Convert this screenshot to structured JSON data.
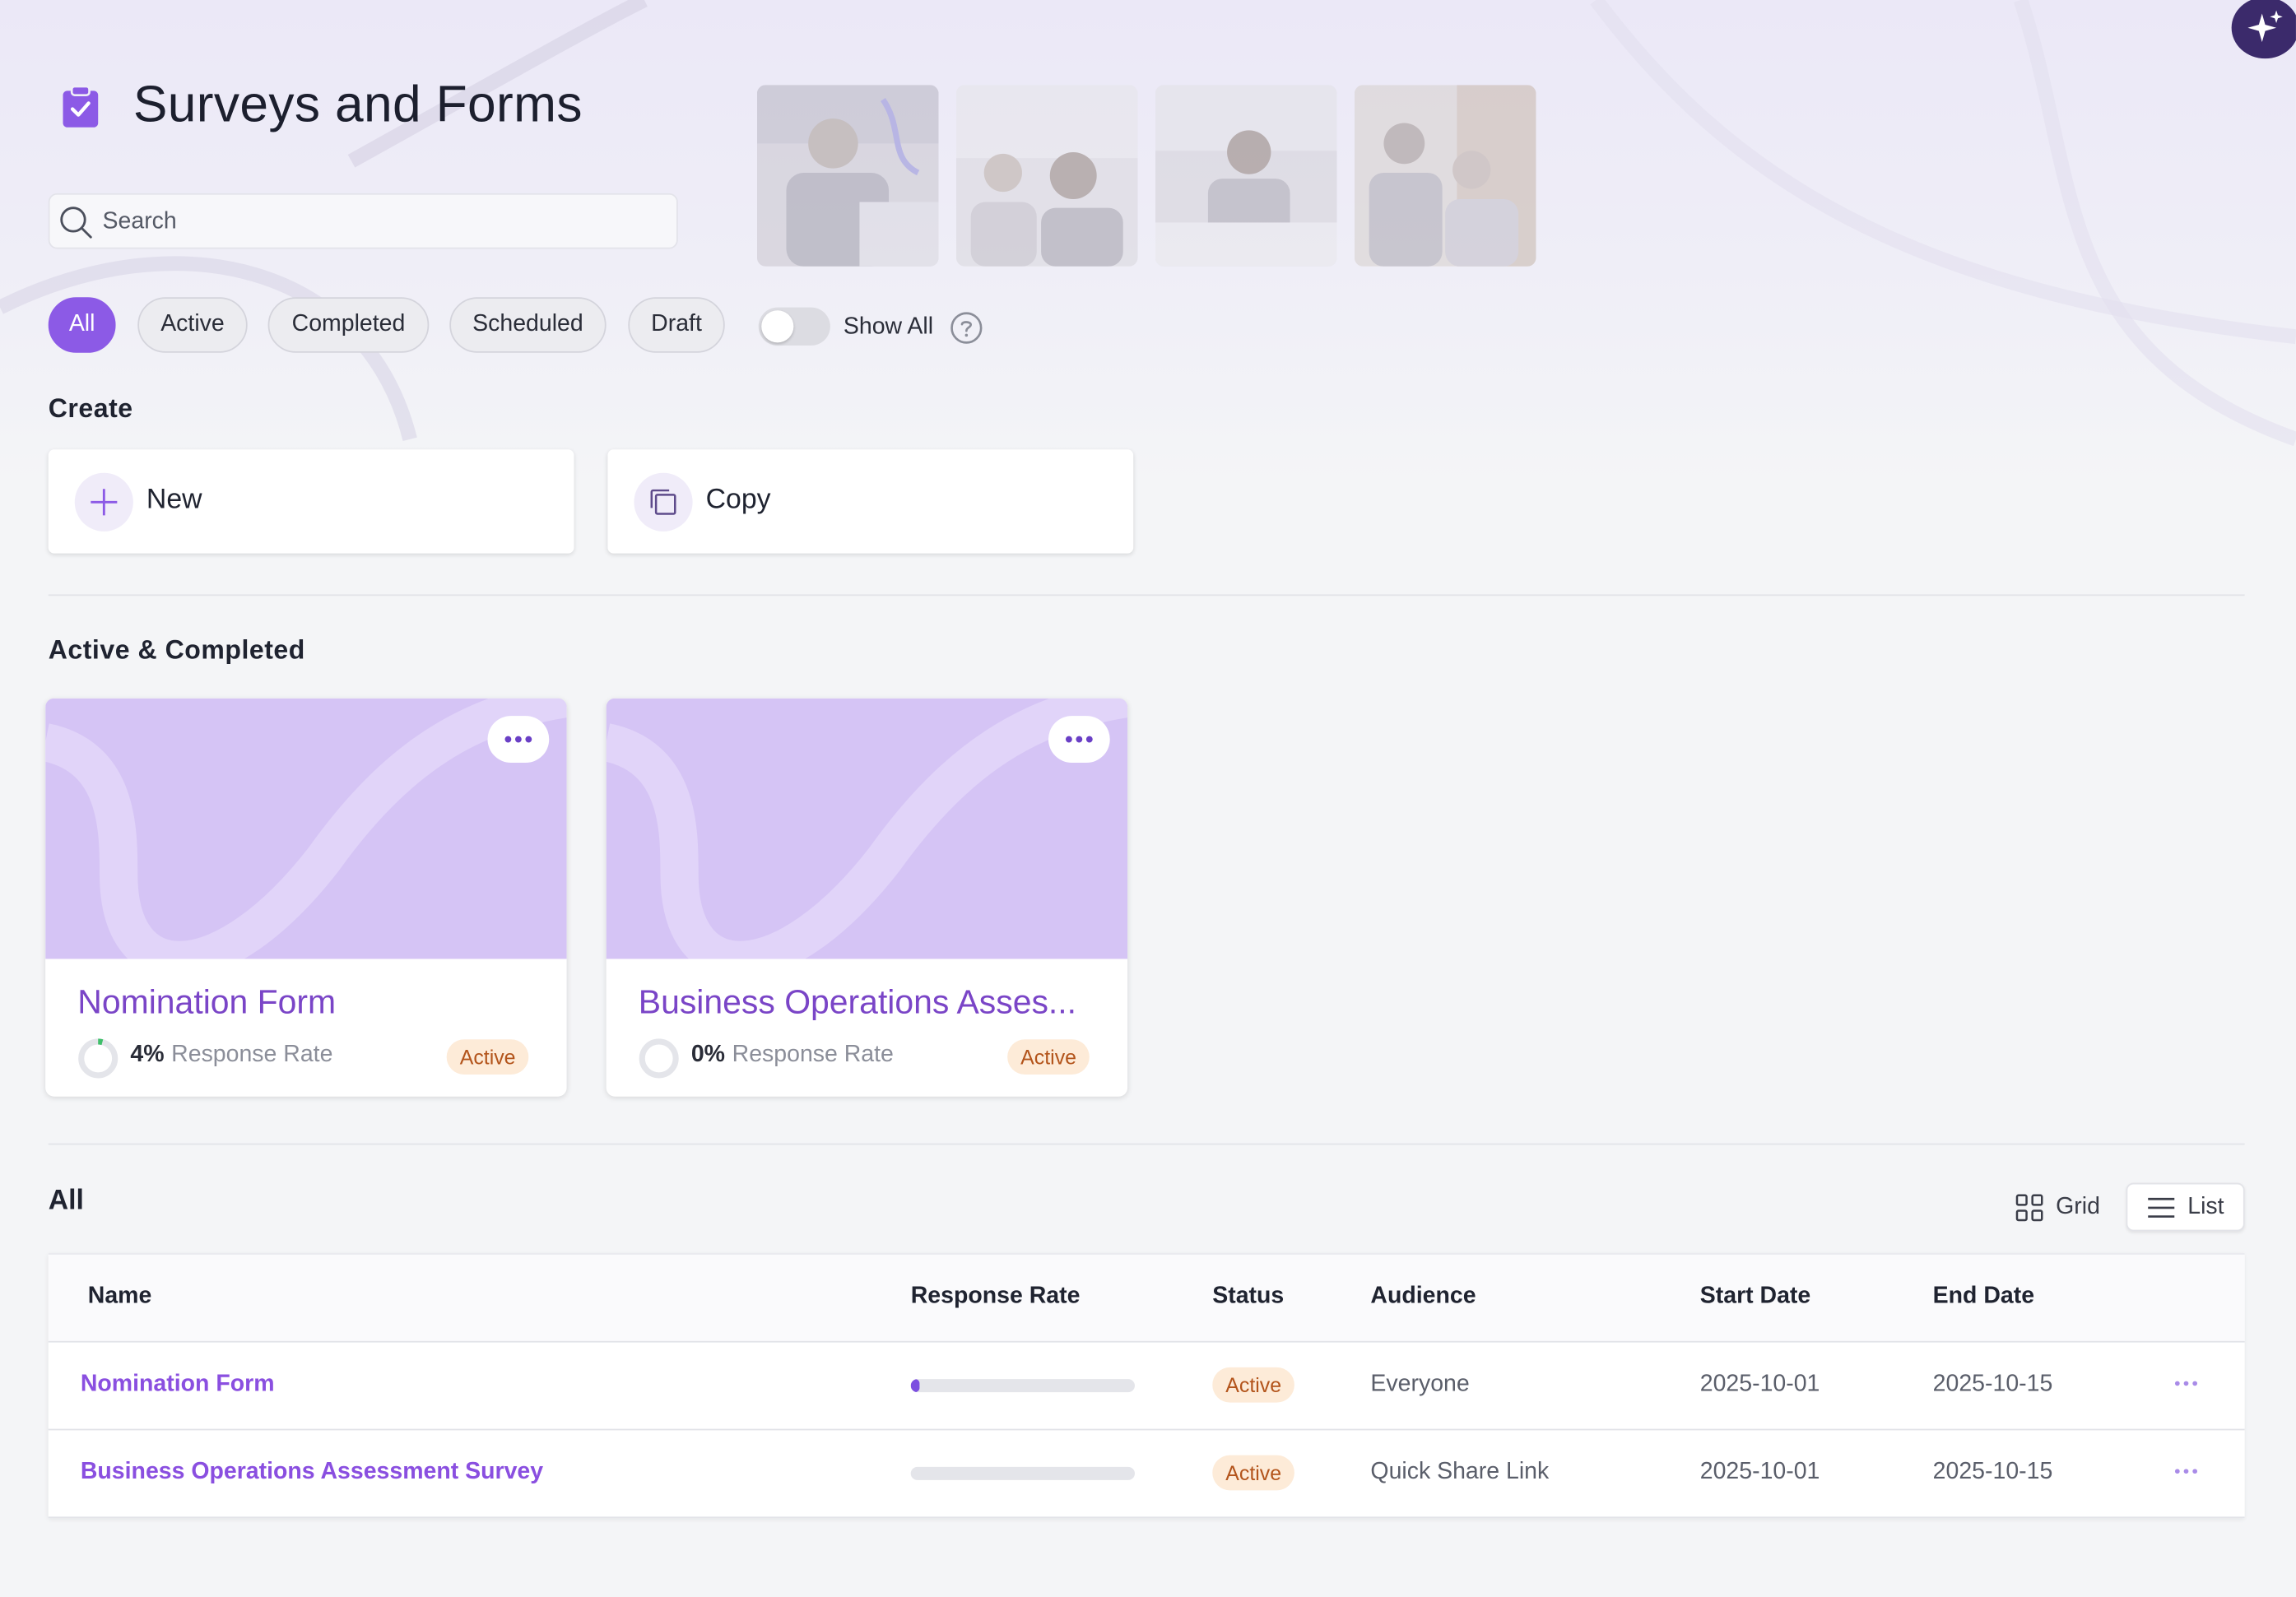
{
  "page": {
    "title": "Surveys and Forms",
    "icon": "clipboard-check-icon"
  },
  "search": {
    "placeholder": "Search"
  },
  "filters": [
    {
      "label": "All",
      "selected": true
    },
    {
      "label": "Active",
      "selected": false
    },
    {
      "label": "Completed",
      "selected": false
    },
    {
      "label": "Scheduled",
      "selected": false
    },
    {
      "label": "Draft",
      "selected": false
    }
  ],
  "show_all": {
    "label": "Show All",
    "on": false
  },
  "create": {
    "title": "Create",
    "new_label": "New",
    "copy_label": "Copy"
  },
  "active_completed": {
    "title": "Active & Completed",
    "cards": [
      {
        "title": "Nomination Form",
        "percent": "4%",
        "rate_label": "Response Rate",
        "status": "Active",
        "rate": 0.04
      },
      {
        "title": "Business Operations Asses...",
        "percent": "0%",
        "rate_label": "Response Rate",
        "status": "Active",
        "rate": 0
      }
    ]
  },
  "all": {
    "title": "All",
    "grid_label": "Grid",
    "list_label": "List",
    "columns": {
      "name": "Name",
      "response_rate": "Response Rate",
      "status": "Status",
      "audience": "Audience",
      "start_date": "Start Date",
      "end_date": "End Date"
    },
    "rows": [
      {
        "name": "Nomination Form",
        "rate": 0.04,
        "status": "Active",
        "audience": "Everyone",
        "start": "2025-10-01",
        "end": "2025-10-15"
      },
      {
        "name": "Business Operations Assessment Survey",
        "rate": 0,
        "status": "Active",
        "audience": "Quick Share Link",
        "start": "2025-10-01",
        "end": "2025-10-15"
      }
    ]
  },
  "colors": {
    "accent": "#8c5ae6",
    "link": "#8a4fe0",
    "banner": "#d5c4f5",
    "badge_bg": "#fdebd8",
    "badge_text": "#b3541b"
  }
}
